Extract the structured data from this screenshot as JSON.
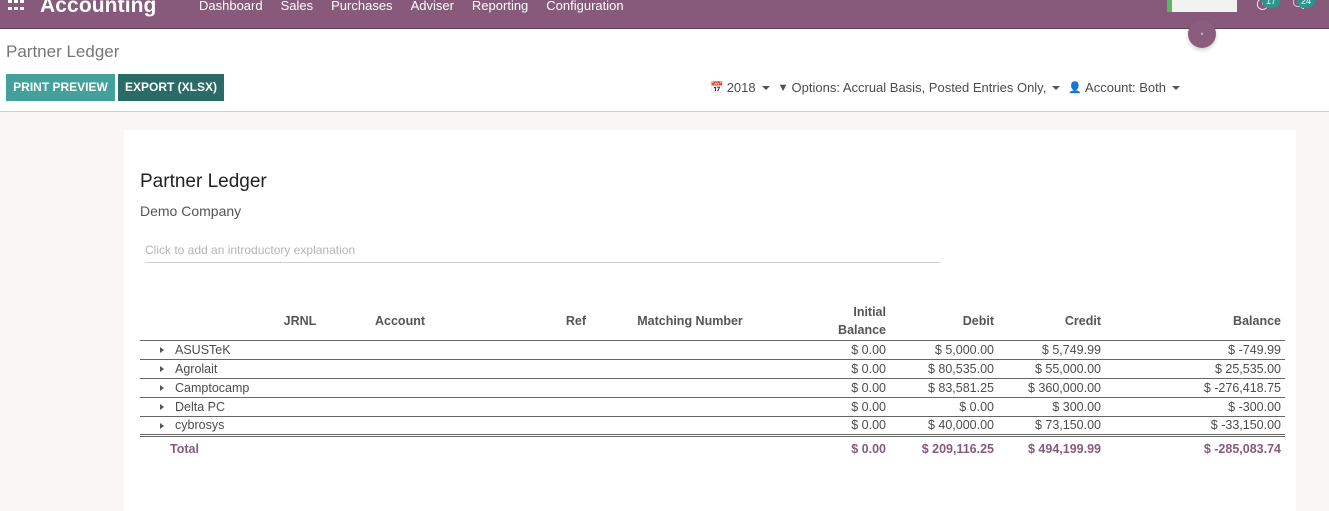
{
  "navbar": {
    "app_name": "Accounting",
    "menu": [
      "Dashboard",
      "Sales",
      "Purchases",
      "Adviser",
      "Reporting",
      "Configuration"
    ],
    "activity_count": "17",
    "messages_count": "24",
    "brand_color": "#875a7b"
  },
  "control_panel": {
    "breadcrumb": "Partner Ledger",
    "print_preview_label": "PRINT PREVIEW",
    "export_label": "EXPORT (XLSX)",
    "filters": {
      "date": "2018",
      "options": "Options: Accrual Basis, Posted Entries Only,",
      "account": "Account: Both"
    }
  },
  "report": {
    "title": "Partner Ledger",
    "company": "Demo Company",
    "intro_placeholder": "Click to add an introductory explanation",
    "columns": {
      "partner": "",
      "jrnl": "JRNL",
      "account": "Account",
      "ref": "Ref",
      "matching": "Matching Number",
      "initial_line1": "Initial",
      "initial_line2": "Balance",
      "debit": "Debit",
      "credit": "Credit",
      "balance": "Balance"
    },
    "rows": [
      {
        "partner": "ASUSTeK",
        "initial": "$ 0.00",
        "debit": "$ 5,000.00",
        "credit": "$ 5,749.99",
        "balance": "$ -749.99"
      },
      {
        "partner": "Agrolait",
        "initial": "$ 0.00",
        "debit": "$ 80,535.00",
        "credit": "$ 55,000.00",
        "balance": "$ 25,535.00"
      },
      {
        "partner": "Camptocamp",
        "initial": "$ 0.00",
        "debit": "$ 83,581.25",
        "credit": "$ 360,000.00",
        "balance": "$ -276,418.75"
      },
      {
        "partner": "Delta PC",
        "initial": "$ 0.00",
        "debit": "$ 0.00",
        "credit": "$ 300.00",
        "balance": "$ -300.00"
      },
      {
        "partner": "cybrosys",
        "initial": "$ 0.00",
        "debit": "$ 40,000.00",
        "credit": "$ 73,150.00",
        "balance": "$ -33,150.00"
      }
    ],
    "total": {
      "label": "Total",
      "initial": "$ 0.00",
      "debit": "$ 209,116.25",
      "credit": "$ 494,199.99",
      "balance": "$ -285,083.74"
    }
  }
}
